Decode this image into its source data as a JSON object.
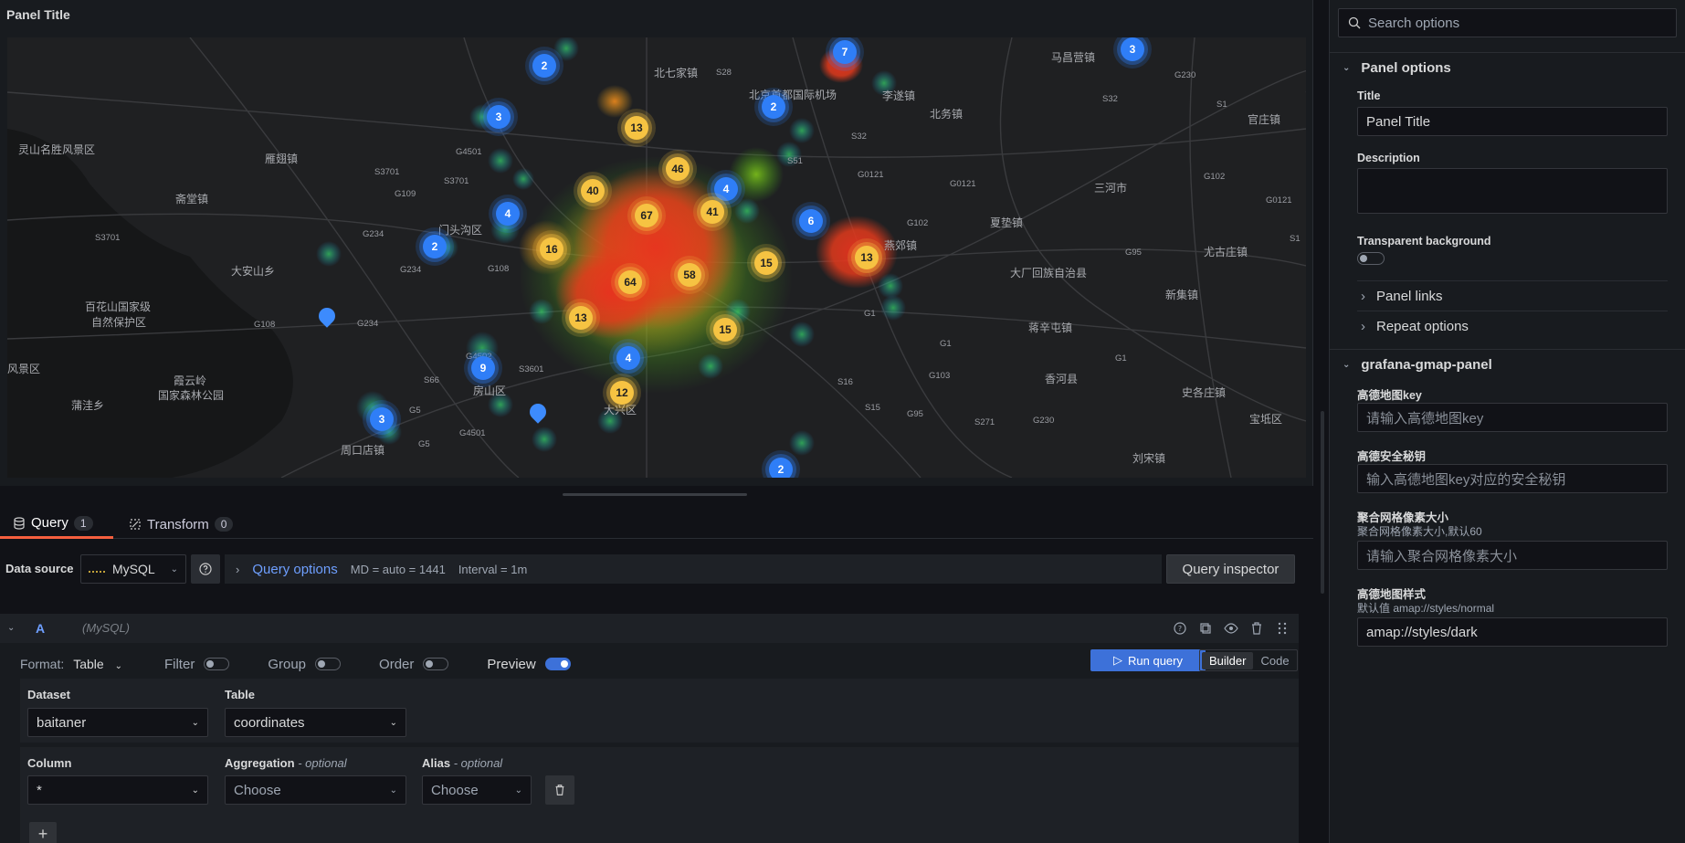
{
  "panel": {
    "title": "Panel Title"
  },
  "map": {
    "labels": [
      "灵山名胜风景区",
      "雁翅镇",
      "斋堂镇",
      "大安山乡",
      "百花山国家级",
      "自然保护区",
      "风景区",
      "蒲洼乡",
      "霞云岭",
      "国家森林公园",
      "周口店镇",
      "北七家镇",
      "北京首都国际机场",
      "李遂镇",
      "北务镇",
      "马昌营镇",
      "官庄镇",
      "三河市",
      "夏垫镇",
      "大厂回族自治县",
      "燕郊镇",
      "尤古庄镇",
      "新集镇",
      "蒋辛屯镇",
      "香河县",
      "史各庄镇",
      "宝坻区",
      "刘宋镇",
      "门头沟区",
      "房山区",
      "大兴区"
    ],
    "road_labels": [
      "G4501",
      "S3701",
      "S3701",
      "G109",
      "S3701",
      "G234",
      "G234",
      "G108",
      "G108",
      "G234",
      "S28",
      "S32",
      "S51",
      "G0121",
      "G102",
      "G0121",
      "S32",
      "G230",
      "S1",
      "G102",
      "G0121",
      "S1",
      "G95",
      "G1",
      "G1",
      "G103",
      "G1",
      "S16",
      "S15",
      "G95",
      "S271",
      "G230",
      "S66",
      "S3601",
      "G5",
      "G4501",
      "G5",
      "G4502"
    ],
    "clusters_blue": [
      "2",
      "3",
      "4",
      "2",
      "4",
      "6",
      "2",
      "7",
      "3",
      "9",
      "3",
      "4",
      "2"
    ],
    "clusters_yellow": [
      "13",
      "46",
      "40",
      "67",
      "41",
      "16",
      "15",
      "13",
      "64",
      "58",
      "13",
      "15",
      "12"
    ]
  },
  "tabs": {
    "query_label": "Query",
    "query_count": "1",
    "transform_label": "Transform",
    "transform_count": "0"
  },
  "datasource": {
    "label": "Data source",
    "selected": "MySQL",
    "query_options": "Query options",
    "md": "MD = auto = 1441",
    "interval": "Interval = 1m",
    "inspector": "Query inspector"
  },
  "query": {
    "letter": "A",
    "ds_name": "(MySQL)",
    "format_label": "Format:",
    "format_value": "Table",
    "filter": "Filter",
    "group": "Group",
    "order": "Order",
    "preview": "Preview",
    "run": "Run query",
    "builder": "Builder",
    "code": "Code",
    "dataset_label": "Dataset",
    "dataset_value": "baitaner",
    "table_label": "Table",
    "table_value": "coordinates",
    "column_label": "Column",
    "column_value": "*",
    "aggregation_label": "Aggregation",
    "aggregation_opt": "- optional",
    "aggregation_value": "Choose",
    "alias_label": "Alias",
    "alias_opt": "- optional",
    "alias_value": "Choose",
    "add": "+"
  },
  "options": {
    "search_placeholder": "Search options",
    "panel_options": "Panel options",
    "title_label": "Title",
    "title_value": "Panel Title",
    "description_label": "Description",
    "transparent_label": "Transparent background",
    "panel_links": "Panel links",
    "repeat_options": "Repeat options",
    "plugin_section": "grafana-gmap-panel",
    "key_label": "高德地图key",
    "key_placeholder": "请输入高德地图key",
    "secret_label": "高德安全秘钥",
    "secret_placeholder": "输入高德地图key对应的安全秘钥",
    "grid_label": "聚合网格像素大小",
    "grid_desc": "聚合网格像素大小,默认60",
    "grid_placeholder": "请输入聚合网格像素大小",
    "style_label": "高德地图样式",
    "style_desc": "默认值 amap://styles/normal",
    "style_value": "amap://styles/dark"
  },
  "colors": {
    "accent": "#3d71d9",
    "tab_active": "#f55f3e",
    "cluster_blue": "#2f7ef7",
    "cluster_yellow": "#f6c342"
  }
}
